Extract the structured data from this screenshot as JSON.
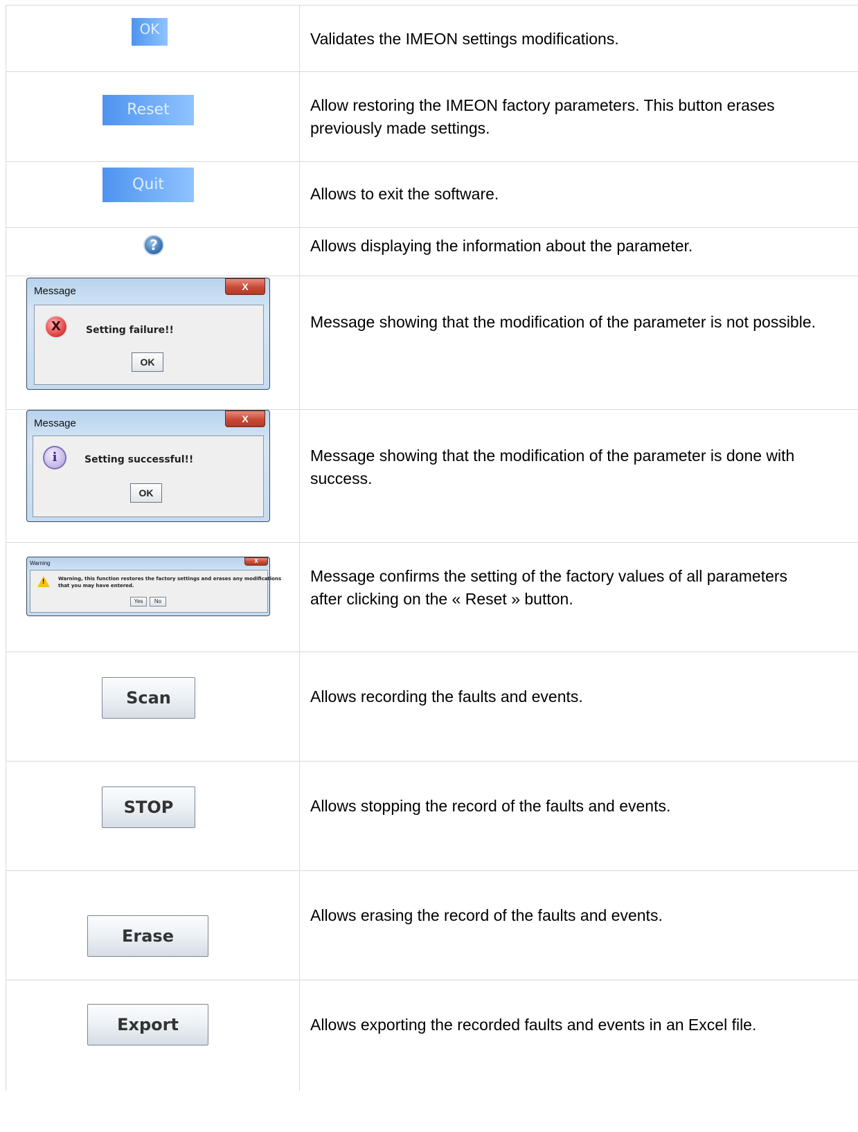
{
  "rows": [
    {
      "button_label": "OK",
      "description": "Validates the IMEON settings modifications."
    },
    {
      "button_label": "Reset",
      "description": "Allow restoring the IMEON factory parameters. This button erases previously made settings."
    },
    {
      "button_label": "Quit",
      "description": "Allows to exit the software."
    },
    {
      "icon": "help-icon",
      "icon_glyph": "?",
      "description": "Allows displaying the information about the parameter."
    },
    {
      "dialog": {
        "title": "Message",
        "icon": "error-icon",
        "icon_glyph": "X",
        "message": "Setting failure!!",
        "ok_label": "OK"
      },
      "description": "Message showing that the modification of the parameter is not possible."
    },
    {
      "dialog": {
        "title": "Message",
        "icon": "info-icon",
        "icon_glyph": "i",
        "message": "Setting successful!!",
        "ok_label": "OK"
      },
      "description": "Message showing that the modification of the parameter is done with success."
    },
    {
      "dialog": {
        "title": "Warning",
        "icon": "warning-icon",
        "icon_glyph": "!",
        "message_line1": "Warning, this function restores the factory settings and erases any modifications",
        "message_line2": "that you may have entered.",
        "yes_label": "Yes",
        "no_label": "No"
      },
      "description": "Message confirms the setting of the factory values of all parameters after clicking on the « Reset » button."
    },
    {
      "button_label": "Scan",
      "description": "Allows recording the faults and events."
    },
    {
      "button_label": "STOP",
      "description": "Allows stopping the record of the faults and events."
    },
    {
      "button_label": "Erase",
      "description": "Allows erasing the record of the faults and events."
    },
    {
      "button_label": "Export",
      "description": "Allows exporting the recorded faults and events in an Excel file."
    }
  ],
  "dialog_close_glyph": "X",
  "colors": {
    "border": "#d9d9d9",
    "blue_button_start": "#4f93ef",
    "blue_button_end": "#8fc3ff",
    "close_button": "#c74a36"
  }
}
